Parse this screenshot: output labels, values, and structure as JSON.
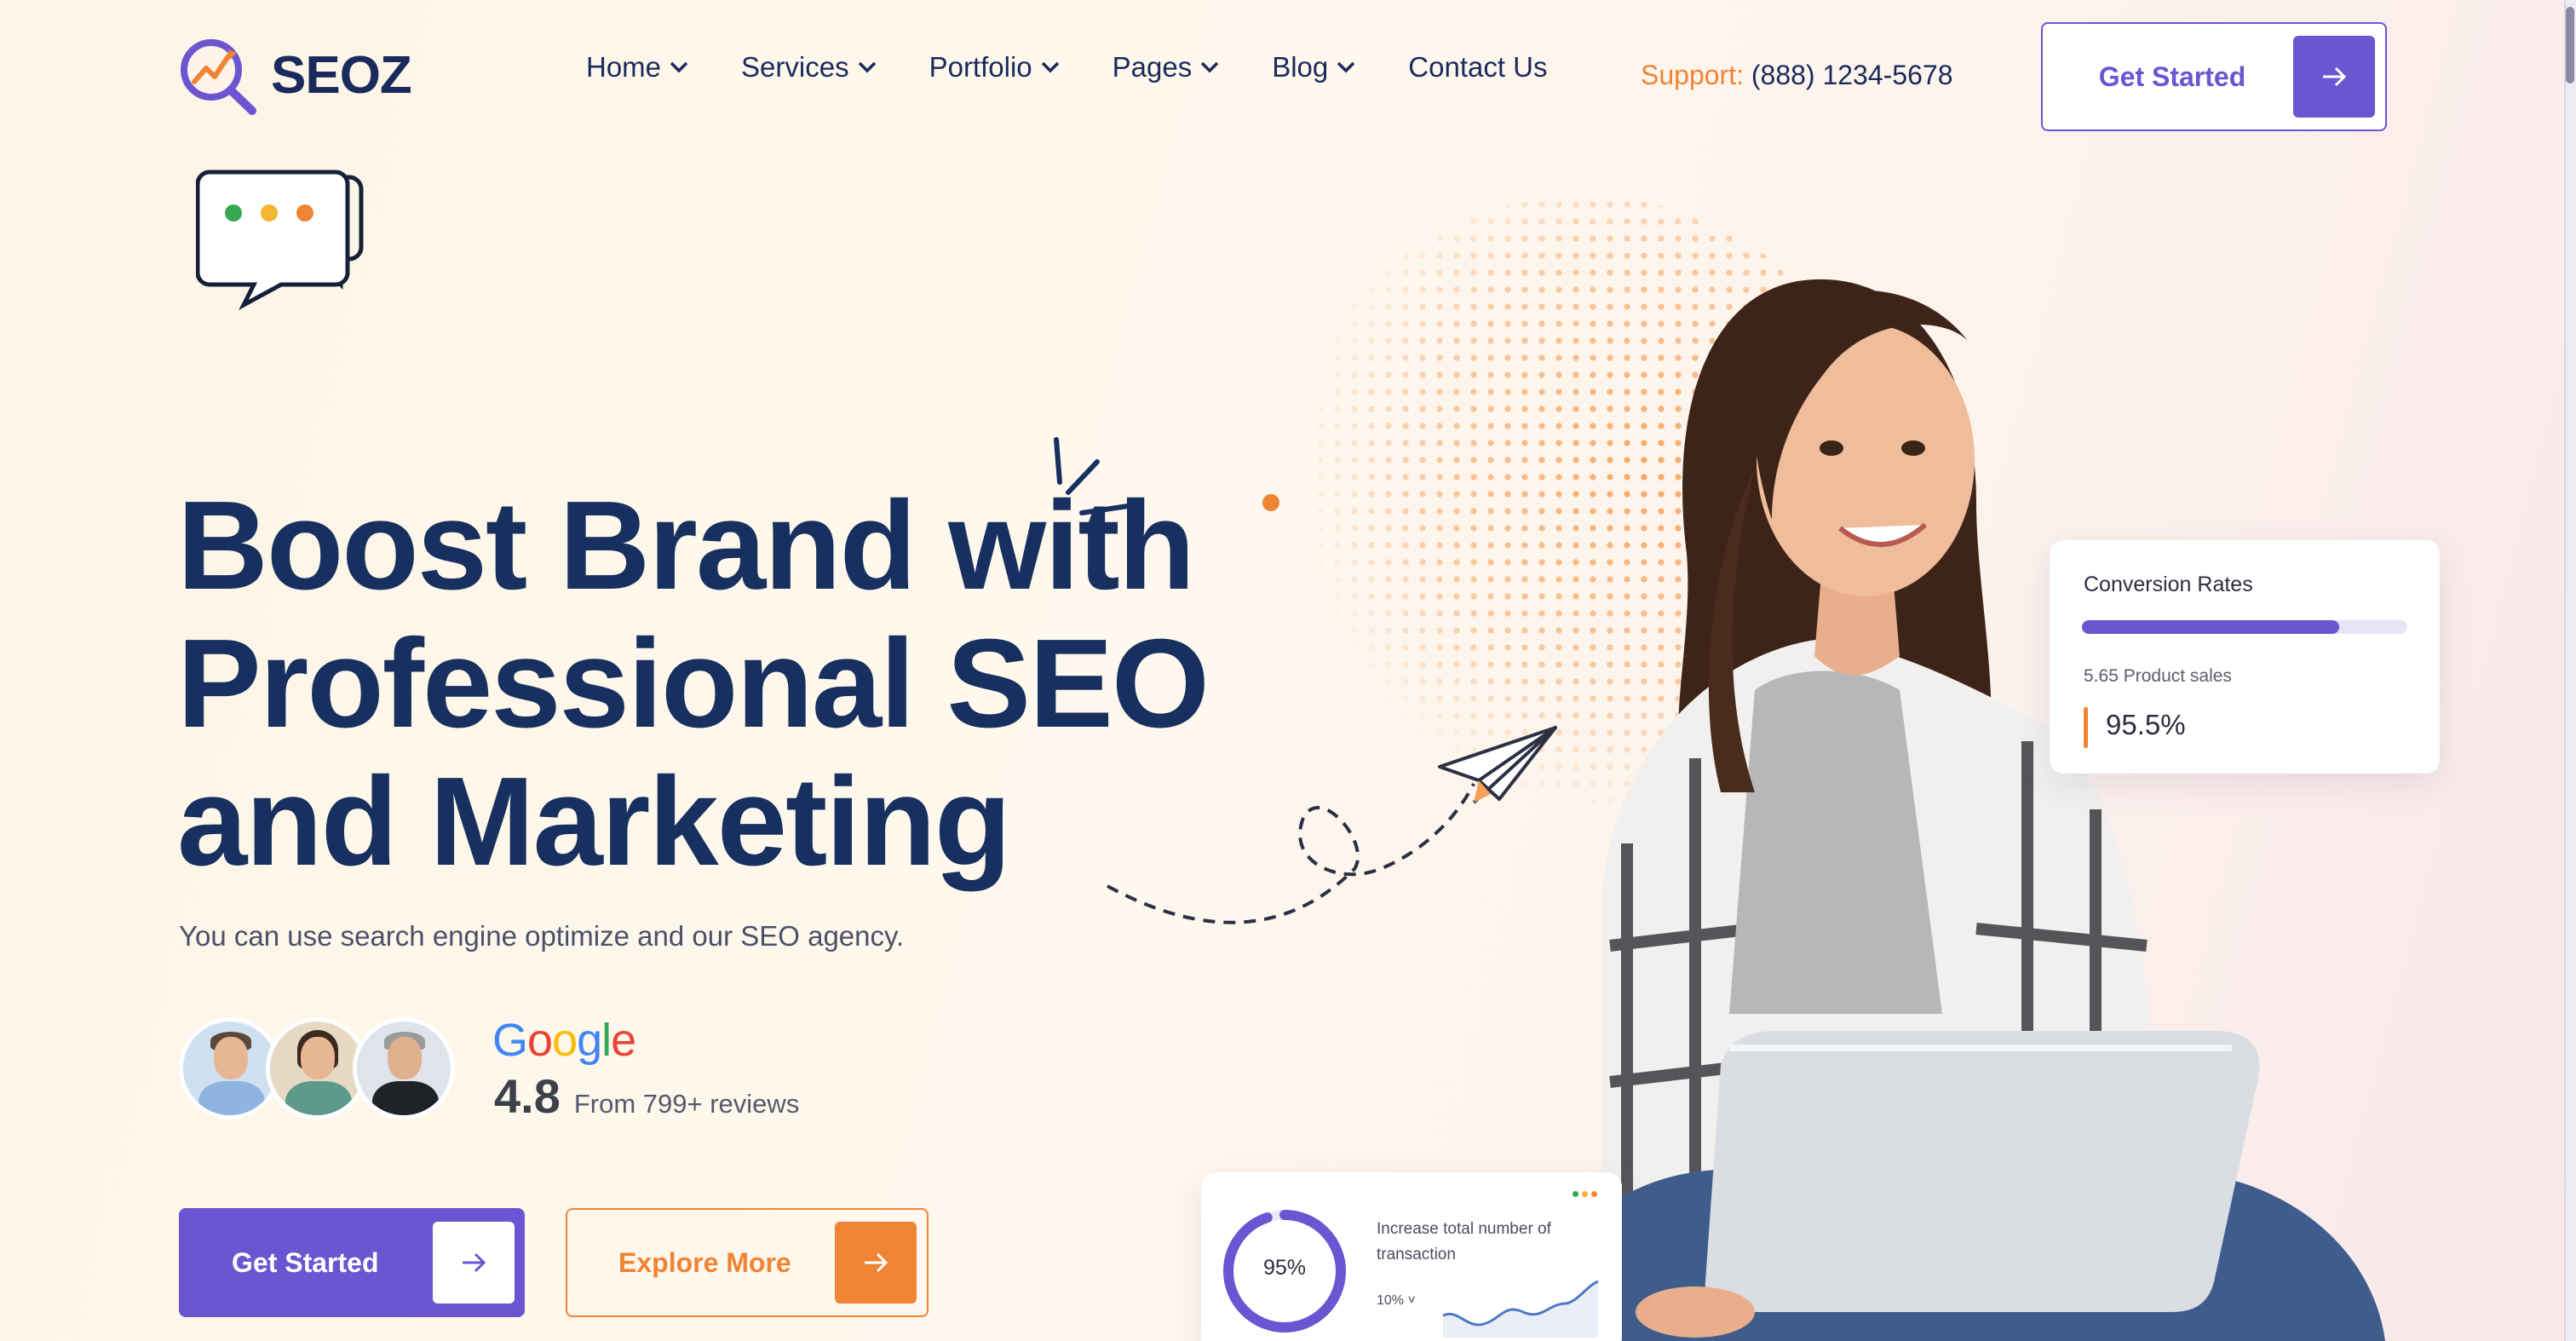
{
  "brand": {
    "name": "SEOZ"
  },
  "nav": {
    "items": [
      {
        "label": "Home",
        "has_dropdown": true
      },
      {
        "label": "Services",
        "has_dropdown": true
      },
      {
        "label": "Portfolio",
        "has_dropdown": true
      },
      {
        "label": "Pages",
        "has_dropdown": true
      },
      {
        "label": "Blog",
        "has_dropdown": true
      },
      {
        "label": "Contact Us",
        "has_dropdown": false
      }
    ]
  },
  "support": {
    "label": "Support:",
    "phone": "(888) 1234-5678"
  },
  "header_cta": {
    "label": "Get Started"
  },
  "hero": {
    "title_lines": [
      "Boost Brand with",
      "Professional SEO",
      "and Marketing"
    ],
    "subtitle": "You can use search engine optimize and our SEO agency."
  },
  "reviews": {
    "provider_letters": [
      "G",
      "o",
      "o",
      "g",
      "l",
      "e"
    ],
    "rating": "4.8",
    "count_text": "From 799+ reviews"
  },
  "buttons": {
    "primary": "Get Started",
    "secondary": "Explore More"
  },
  "conversion_card": {
    "title": "Conversion Rates",
    "progress": 0.79,
    "sub_label": "5.65 Product sales",
    "percent": "95.5%"
  },
  "transaction_card": {
    "donut_value": "95%",
    "donut_fraction": 0.95,
    "description": "Increase total number of transaction",
    "mini_select": "10% ˅"
  },
  "colors": {
    "primary": "#6c55d1",
    "accent": "#f08435",
    "heading": "#17305f"
  },
  "icons": {
    "logo": "magnifier-chart-icon",
    "chat": "chat-bubble-icon",
    "arrow": "arrow-right-icon",
    "chevron": "chevron-down-icon",
    "plane": "paper-plane-icon"
  }
}
